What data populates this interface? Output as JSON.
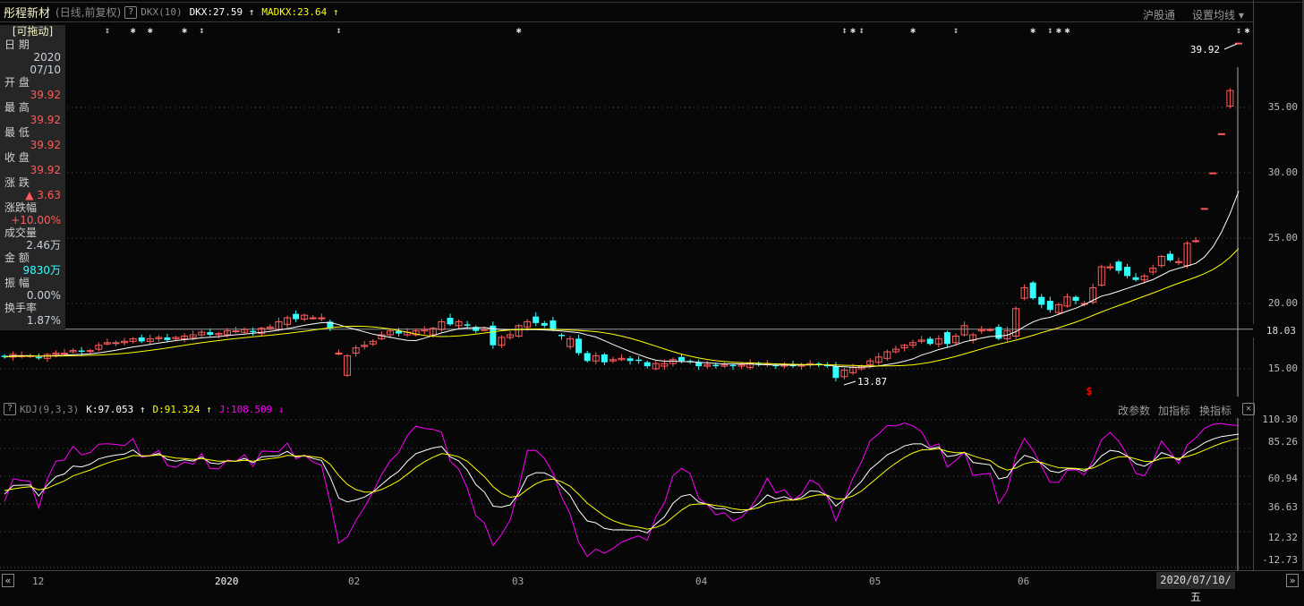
{
  "header": {
    "title": "彤程新材",
    "period": "(日线,前复权)",
    "help": "?",
    "indicator": "DKX(10)",
    "dkx": "DKX:27.59 ↑",
    "madkx": "MADKX:23.64 ↑",
    "btn_hsgt": "沪股通",
    "btn_ma": "设置均线 ▾"
  },
  "info": {
    "drag": "[可拖动]",
    "rows": [
      {
        "label": "日  期",
        "value": "2020",
        "value2": "07/10",
        "cls": "gr"
      },
      {
        "label": "开  盘",
        "value": "39.92",
        "cls": "red"
      },
      {
        "label": "最  高",
        "value": "39.92",
        "cls": "red"
      },
      {
        "label": "最  低",
        "value": "39.92",
        "cls": "red"
      },
      {
        "label": "收  盘",
        "value": "39.92",
        "cls": "red"
      },
      {
        "label": "涨  跌",
        "value": "▲ 3.63",
        "cls": "red"
      },
      {
        "label": "涨跌幅",
        "value": "+10.00%",
        "cls": "red"
      },
      {
        "label": "成交量",
        "value": "2.46万",
        "cls": "gr"
      },
      {
        "label": "金  额",
        "value": "9830万",
        "cls": "cy"
      },
      {
        "label": "振  幅",
        "value": "0.00%",
        "cls": "gr"
      },
      {
        "label": "换手率",
        "value": "1.87%",
        "cls": "gr"
      }
    ]
  },
  "price_axis": {
    "ticks": [
      "35.00",
      "30.00",
      "25.00",
      "20.00",
      "15.00"
    ],
    "current": "18.03"
  },
  "annotations": {
    "high": "39.92",
    "low": "13.87",
    "signal": "$"
  },
  "kdj": {
    "help": "?",
    "name": "KDJ(9,3,3)",
    "k": "K:97.053 ↑",
    "d": "D:91.324 ↑",
    "j": "J:108.509 ↓",
    "btn_params": "改参数",
    "btn_add": "加指标",
    "btn_switch": "换指标",
    "close": "✕",
    "ticks": [
      "110.30",
      "85.26",
      "60.94",
      "36.63",
      "12.32",
      "-12.73"
    ]
  },
  "date_axis": {
    "labels": [
      "12",
      "2020",
      "02",
      "03",
      "04",
      "05",
      "06"
    ],
    "current": "2020/07/10/五",
    "prev": "«",
    "next": "»"
  },
  "colors": {
    "up": "#ff5b5b",
    "down": "#33ffff",
    "dkx": "#ffffff",
    "madkx": "#ffff00",
    "j": "#ff00ff"
  },
  "chart_data": {
    "type": "candlestick",
    "price_range": [
      13.2,
      43.0
    ],
    "reference_line": 18.03,
    "signals": [
      [
        12,
        "↕"
      ],
      [
        15,
        "✱"
      ],
      [
        17,
        "✱"
      ],
      [
        21,
        "✱"
      ],
      [
        23,
        "↕"
      ],
      [
        39,
        "↕"
      ],
      [
        60,
        "✱"
      ],
      [
        98,
        "↕"
      ],
      [
        99,
        "✱"
      ],
      [
        100,
        "↕"
      ],
      [
        106,
        "✱"
      ],
      [
        111,
        "↕"
      ],
      [
        120,
        "✱"
      ],
      [
        122,
        "↕"
      ],
      [
        123,
        "✱"
      ],
      [
        124,
        "✱"
      ],
      [
        144,
        "↕"
      ],
      [
        145,
        "✱"
      ]
    ],
    "candles_oc": [
      [
        16.0,
        15.9
      ],
      [
        15.9,
        16.1
      ],
      [
        16.0,
        16.0
      ],
      [
        16.0,
        16.0
      ],
      [
        15.9,
        15.8
      ],
      [
        15.8,
        16.1
      ],
      [
        16.1,
        16.2
      ],
      [
        16.2,
        16.2
      ],
      [
        16.3,
        16.4
      ],
      [
        16.4,
        16.3
      ],
      [
        16.4,
        16.4
      ],
      [
        16.5,
        16.8
      ],
      [
        16.9,
        17.0
      ],
      [
        17.0,
        17.0
      ],
      [
        17.0,
        17.1
      ],
      [
        17.1,
        17.3
      ],
      [
        17.4,
        17.1
      ],
      [
        17.1,
        17.3
      ],
      [
        17.3,
        17.4
      ],
      [
        17.4,
        17.2
      ],
      [
        17.3,
        17.4
      ],
      [
        17.3,
        17.5
      ],
      [
        17.4,
        17.6
      ],
      [
        17.6,
        17.8
      ],
      [
        17.8,
        17.6
      ],
      [
        17.6,
        17.7
      ],
      [
        17.6,
        17.9
      ],
      [
        17.9,
        17.9
      ],
      [
        17.8,
        18.0
      ],
      [
        17.9,
        17.8
      ],
      [
        17.7,
        18.1
      ],
      [
        18.1,
        18.2
      ],
      [
        18.0,
        18.6
      ],
      [
        18.4,
        18.9
      ],
      [
        19.2,
        18.8
      ],
      [
        18.8,
        19.1
      ],
      [
        18.9,
        18.9
      ],
      [
        18.9,
        18.9
      ],
      [
        18.6,
        18.1
      ],
      [
        16.2,
        16.2
      ],
      [
        14.5,
        16.0
      ],
      [
        16.2,
        16.6
      ],
      [
        16.7,
        16.8
      ],
      [
        16.9,
        17.1
      ],
      [
        17.3,
        17.6
      ],
      [
        17.6,
        17.9
      ],
      [
        17.9,
        17.7
      ],
      [
        17.6,
        17.8
      ],
      [
        17.6,
        17.9
      ],
      [
        17.9,
        18.0
      ],
      [
        17.6,
        18.1
      ],
      [
        18.0,
        18.6
      ],
      [
        18.9,
        18.4
      ],
      [
        18.3,
        18.6
      ],
      [
        18.4,
        18.3
      ],
      [
        18.2,
        17.9
      ],
      [
        18.0,
        18.0
      ],
      [
        18.3,
        16.8
      ],
      [
        16.8,
        17.4
      ],
      [
        17.4,
        17.6
      ],
      [
        17.5,
        18.3
      ],
      [
        18.2,
        18.6
      ],
      [
        19.0,
        18.5
      ],
      [
        18.5,
        18.3
      ],
      [
        18.7,
        18.0
      ],
      [
        17.6,
        17.5
      ],
      [
        16.7,
        17.3
      ],
      [
        17.3,
        16.2
      ],
      [
        16.2,
        15.6
      ],
      [
        15.6,
        16.0
      ],
      [
        16.1,
        15.5
      ],
      [
        15.6,
        15.7
      ],
      [
        15.7,
        15.8
      ],
      [
        15.8,
        15.6
      ],
      [
        15.7,
        15.6
      ],
      [
        15.5,
        15.2
      ],
      [
        15.0,
        15.4
      ],
      [
        15.2,
        15.4
      ],
      [
        15.4,
        15.7
      ],
      [
        15.9,
        15.6
      ],
      [
        15.6,
        15.5
      ],
      [
        15.5,
        15.2
      ],
      [
        15.2,
        15.3
      ],
      [
        15.3,
        15.2
      ],
      [
        15.2,
        15.3
      ],
      [
        15.3,
        15.2
      ],
      [
        15.2,
        15.3
      ],
      [
        15.1,
        15.4
      ],
      [
        15.4,
        15.3
      ],
      [
        15.4,
        15.4
      ],
      [
        15.3,
        15.2
      ],
      [
        15.2,
        15.3
      ],
      [
        15.3,
        15.2
      ],
      [
        15.2,
        15.3
      ],
      [
        15.3,
        15.4
      ],
      [
        15.4,
        15.3
      ],
      [
        15.3,
        15.2
      ],
      [
        15.2,
        14.3
      ],
      [
        14.4,
        14.9
      ],
      [
        14.7,
        15.1
      ],
      [
        15.0,
        15.2
      ],
      [
        15.3,
        15.6
      ],
      [
        15.5,
        15.9
      ],
      [
        15.8,
        16.3
      ],
      [
        16.3,
        16.5
      ],
      [
        16.6,
        16.8
      ],
      [
        16.8,
        17.0
      ],
      [
        17.1,
        17.2
      ],
      [
        17.3,
        16.9
      ],
      [
        16.9,
        17.3
      ],
      [
        17.8,
        16.9
      ],
      [
        17.0,
        17.5
      ],
      [
        17.6,
        18.3
      ],
      [
        17.2,
        17.6
      ],
      [
        17.9,
        18.0
      ],
      [
        18.0,
        18.0
      ],
      [
        18.2,
        17.3
      ],
      [
        17.3,
        17.9
      ],
      [
        17.5,
        19.6
      ],
      [
        20.4,
        21.2
      ],
      [
        21.6,
        20.4
      ],
      [
        20.5,
        19.9
      ],
      [
        20.2,
        19.5
      ],
      [
        19.3,
        19.9
      ],
      [
        19.8,
        20.5
      ],
      [
        20.5,
        20.2
      ],
      [
        20.0,
        20.0
      ],
      [
        20.1,
        21.2
      ],
      [
        21.4,
        22.8
      ],
      [
        22.8,
        22.8
      ],
      [
        23.2,
        22.5
      ],
      [
        22.8,
        22.1
      ],
      [
        22.0,
        21.8
      ],
      [
        21.8,
        22.1
      ],
      [
        22.4,
        22.7
      ],
      [
        22.9,
        23.6
      ],
      [
        23.8,
        23.3
      ],
      [
        23.2,
        23.2
      ],
      [
        22.9,
        24.6
      ],
      [
        24.8,
        24.8
      ],
      [
        27.27,
        27.27
      ],
      [
        29.99,
        29.99
      ],
      [
        32.99,
        32.99
      ],
      [
        35.1,
        36.29
      ],
      [
        39.92,
        39.92
      ]
    ]
  }
}
